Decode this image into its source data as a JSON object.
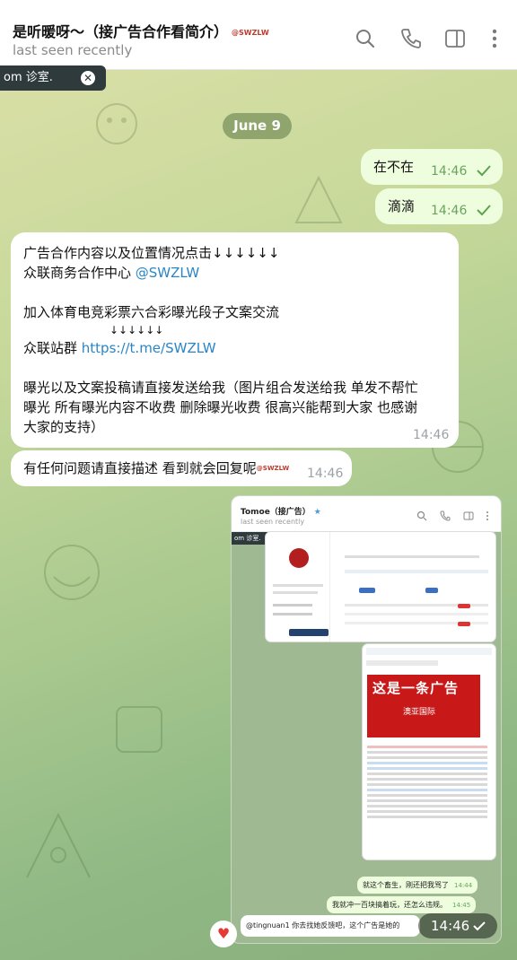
{
  "header": {
    "title": "是听暖呀～（接广告合作看简介）",
    "title_tag": "@SWZLW",
    "status": "last seen recently"
  },
  "icons": [
    "search-icon",
    "phone-icon",
    "sidebar-icon",
    "more-icon"
  ],
  "pinned": {
    "text": "om 诊室.",
    "close": "✕"
  },
  "date_label": "June 9",
  "messages": {
    "out1": {
      "text": "在不在",
      "time": "14:46"
    },
    "out2": {
      "text": "滴滴",
      "time": "14:46"
    },
    "ad": {
      "line1": "广告合作内容以及位置情况点击↓↓↓↓↓↓",
      "line2_text": "众联商务合作中心 ",
      "line2_link": "@SWZLW",
      "line3": "加入体育电竞彩票六合彩曝光段子文案交流",
      "line4": "↓↓↓↓↓↓",
      "line5_text": "众联站群 ",
      "line5_link": "https://t.me/SWZLW",
      "line6": "曝光以及文案投稿请直接发送给我（图片组合发送给我 单发不帮忙",
      "line7": "曝光 所有曝光内容不收费 删除曝光收费 很高兴能帮到大家 也感谢",
      "line8": "大家的支持）",
      "time": "14:46"
    },
    "in2": {
      "text": "有任何问题请直接描述 看到就会回复呢",
      "tag": "@SWZLW",
      "time": "14:46"
    }
  },
  "photo": {
    "header_title": "Tomoe（接广告）",
    "header_status": "last seen recently",
    "pin": "om 诊室.",
    "ad_banner": "这是一条广告",
    "ad_sub": "澳亚国际",
    "msg1": "就这个畜生，刚还把我骂了",
    "msg1_time": "14:44",
    "msg2": "我就冲一百块搞着玩，还怎么违规。",
    "msg2_time": "14:45",
    "reply": "@tingnuan1  你去找她反馈吧，这个广告是她的",
    "time": "14:46",
    "heart": "♥"
  },
  "colors": {
    "outgoing": "#eefdde",
    "time_green": "#6aa35f",
    "link": "#2a85c8",
    "date_pill": "#8fa56d"
  }
}
